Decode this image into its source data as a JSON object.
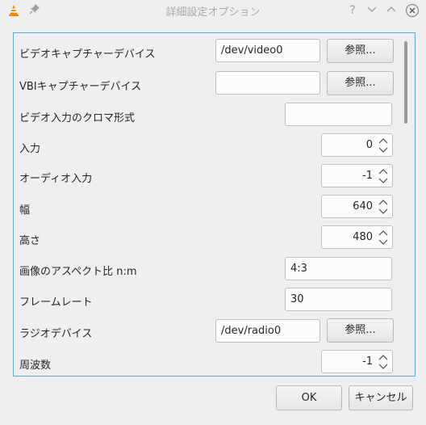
{
  "window": {
    "title": "詳細設定オプション"
  },
  "titlebar": {
    "help_icon": "?",
    "minimize_icon": "⌄",
    "maximize_icon": "⌃",
    "close_icon": "✕"
  },
  "settings": {
    "video_device": {
      "label": "ビデオキャプチャーデバイス",
      "value": "/dev/video0",
      "browse": "参照..."
    },
    "vbi_device": {
      "label": "VBIキャプチャーデバイス",
      "value": "",
      "browse": "参照..."
    },
    "chroma": {
      "label": "ビデオ入力のクロマ形式",
      "value": ""
    },
    "input": {
      "label": "入力",
      "value": "0"
    },
    "audio_input": {
      "label": "オーディオ入力",
      "value": "-1"
    },
    "width": {
      "label": "幅",
      "value": "640"
    },
    "height": {
      "label": "高さ",
      "value": "480"
    },
    "aspect": {
      "label": "画像のアスペクト比 n:m",
      "value": "4:3"
    },
    "framerate": {
      "label": "フレームレート",
      "value": "30"
    },
    "radio_device": {
      "label": "ラジオデバイス",
      "value": "/dev/radio0",
      "browse": "参照..."
    },
    "frequency": {
      "label": "周波数",
      "value": "-1"
    }
  },
  "buttons": {
    "ok": "OK",
    "cancel": "キャンセル"
  },
  "colors": {
    "vlc_orange": "#f08a00",
    "focus_border": "#5da9d4"
  }
}
